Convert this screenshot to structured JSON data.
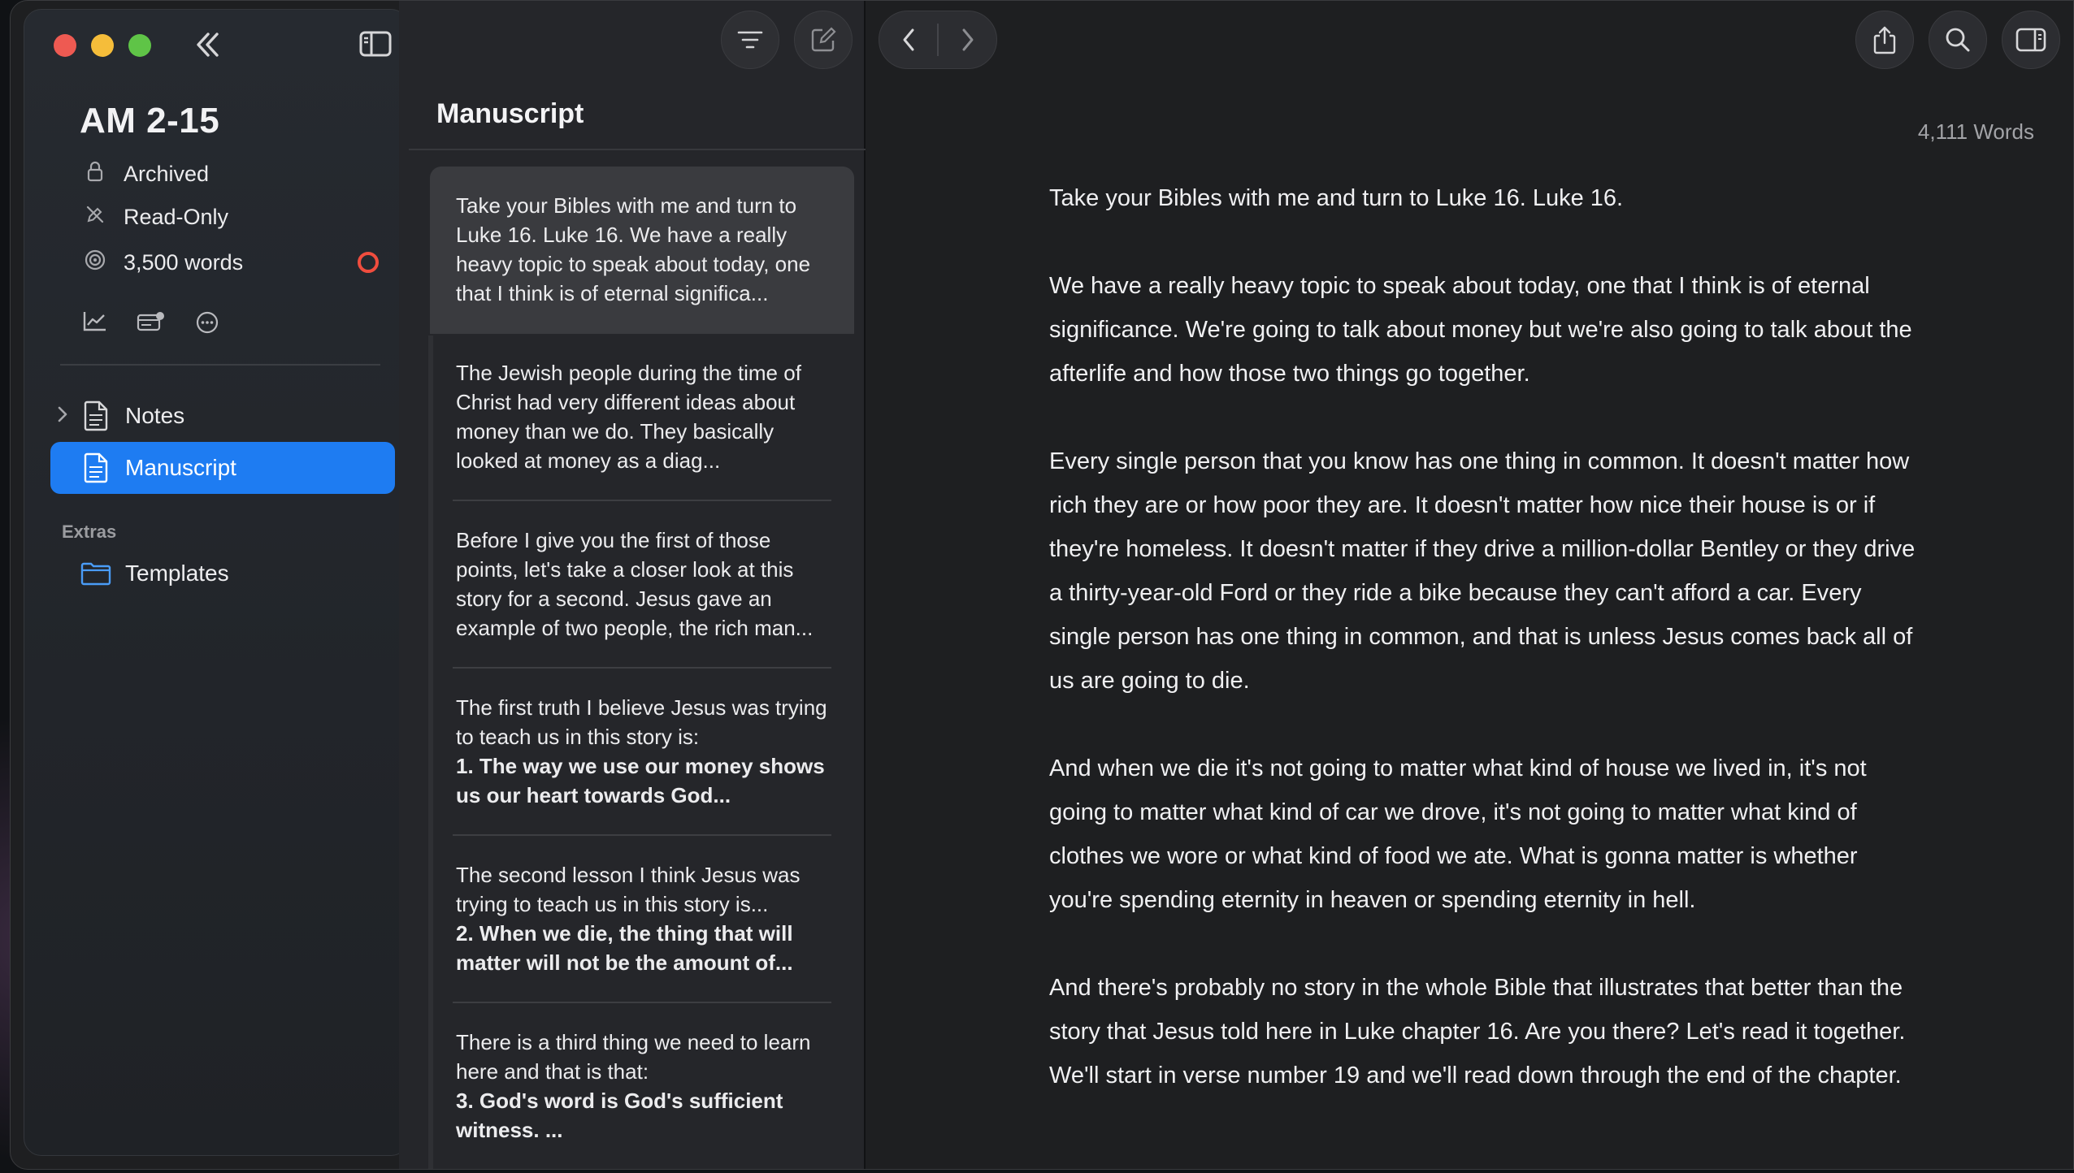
{
  "sidebar": {
    "project_title": "AM 2-15",
    "meta": [
      {
        "icon": "lock-icon",
        "label": "Archived"
      },
      {
        "icon": "pencil-slash-icon",
        "label": "Read-Only"
      },
      {
        "icon": "target-icon",
        "label": "3,500 words"
      }
    ],
    "tree": [
      {
        "label": "Notes",
        "icon": "document-icon",
        "expandable": true,
        "active": false
      },
      {
        "label": "Manuscript",
        "icon": "document-icon",
        "expandable": false,
        "active": true
      }
    ],
    "section_label": "Extras",
    "extras": [
      {
        "label": "Templates",
        "icon": "folder-icon"
      }
    ]
  },
  "list": {
    "title": "Manuscript",
    "cards": [
      {
        "text": "Take your Bibles with me and turn to Luke 16. Luke 16. We have a really heavy topic to speak about today, one that I think is of eternal significa...",
        "bold": ""
      },
      {
        "text": "The Jewish people during the time of Christ had very different ideas about money than we do. They basically looked at money as a diag...",
        "bold": ""
      },
      {
        "text": "Before I give you the first of those points, let's take a closer look at this story for a second. Jesus gave an example of two people, the rich man...",
        "bold": ""
      },
      {
        "text": "The first truth I believe Jesus was trying to teach us in this story is:",
        "bold": "1. The way we use our money shows us our heart towards God..."
      },
      {
        "text": "The second lesson I think Jesus was trying to teach us in this story is...",
        "bold": "2. When we die, the thing that will matter will not be the amount of..."
      },
      {
        "text": "There is a third thing we need to learn here and that is that:",
        "bold": "3. God's word is God's sufficient witness. ..."
      }
    ]
  },
  "editor": {
    "word_count": "4,111 Words",
    "paragraphs": [
      "Take your Bibles with me and turn to Luke 16.  Luke 16.",
      "We have a really heavy topic to speak about today, one that I think is of eternal significance. We're going to talk about money but we're also going to talk about the afterlife and how those two things go together.",
      "Every single person that you know has one thing in common. It doesn't matter how rich they are or how poor they are. It doesn't matter how nice their house is or if they're homeless. It doesn't matter if they drive a million-dollar Bentley or they drive a thirty-year-old Ford or they ride a bike because they can't afford a car. Every single person has one thing in common, and that is unless Jesus comes back all of us are going to die.",
      "And when we die it's not going to matter what kind of house we lived in, it's not going to matter what kind of car we drove, it's not going to matter what kind of clothes we wore or what kind of food we ate. What is gonna matter is whether you're spending eternity in heaven or spending eternity in hell.",
      "And there's probably no story in the whole Bible that illustrates that better than the story that Jesus told here in Luke chapter 16. Are you there? Let's read it together. We'll start in verse number 19 and we'll read down through the end of the chapter."
    ]
  },
  "colors": {
    "accent": "#1e7cf2",
    "goal_ring": "#f04d3e",
    "close": "#ee5a52",
    "minimize": "#f5bd3a",
    "zoom": "#5fc447"
  }
}
